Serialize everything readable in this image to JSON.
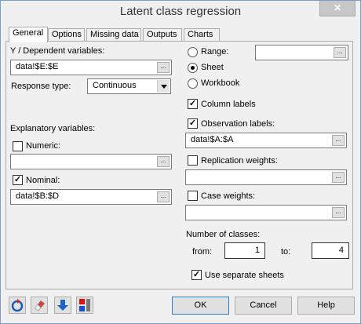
{
  "window": {
    "title": "Latent class regression",
    "close_glyph": "✕"
  },
  "tabs": [
    "General",
    "Options",
    "Missing data",
    "Outputs",
    "Charts"
  ],
  "general": {
    "y_label": "Y / Dependent variables:",
    "y_value": "data!$E:$E",
    "response_label": "Response type:",
    "response_value": "Continuous",
    "explanatory_label": "Explanatory variables:",
    "numeric_label": "Numeric:",
    "numeric_checked": false,
    "numeric_value": "",
    "nominal_label": "Nominal:",
    "nominal_checked": true,
    "nominal_value": "data!$B:$D",
    "range_label": "Range:",
    "range_value": "",
    "sheet_label": "Sheet",
    "workbook_label": "Workbook",
    "output_selected": "Sheet",
    "column_labels_label": "Column labels",
    "column_labels_checked": true,
    "observation_labels_label": "Observation labels:",
    "observation_labels_checked": true,
    "observation_labels_value": "data!$A:$A",
    "replication_label": "Replication weights:",
    "replication_checked": false,
    "replication_value": "",
    "case_weights_label": "Case weights:",
    "case_weights_checked": false,
    "case_weights_value": "",
    "classes_label": "Number of classes:",
    "from_label": "from:",
    "from_value": "1",
    "to_label": "to:",
    "to_value": "4",
    "separate_sheets_label": "Use separate sheets",
    "separate_sheets_checked": true,
    "dots": "..."
  },
  "footer": {
    "ok_label": "OK",
    "cancel_label": "Cancel",
    "help_label": "Help",
    "icons": [
      "reset-icon",
      "eraser-icon",
      "down-arrow-icon",
      "color-bars-icon"
    ]
  }
}
